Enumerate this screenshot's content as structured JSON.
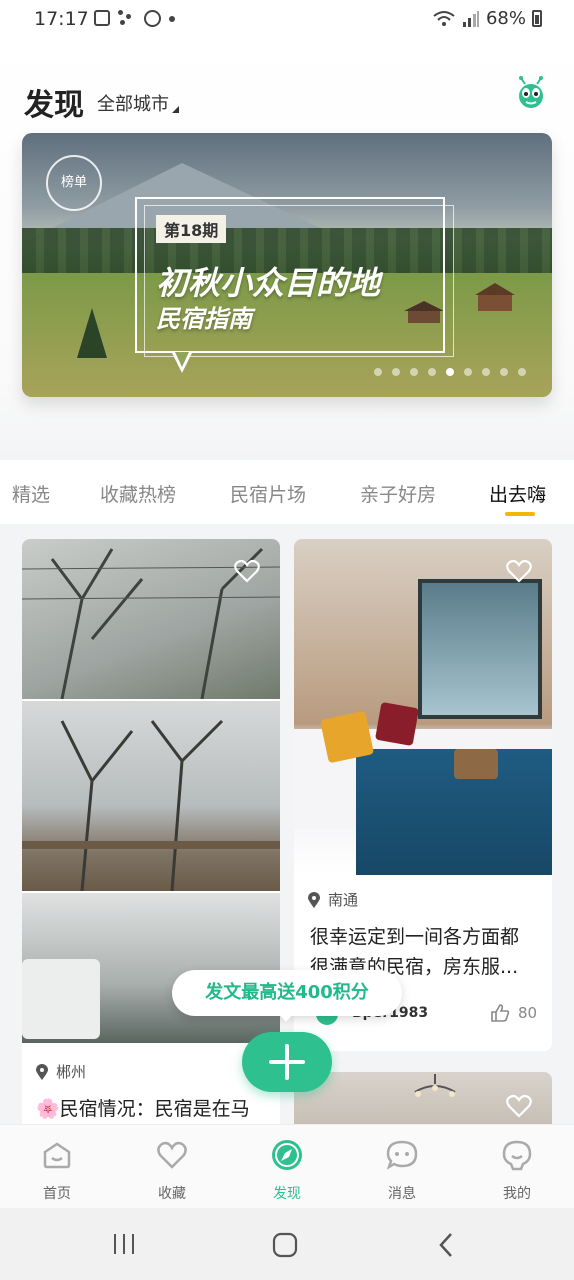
{
  "status_bar": {
    "time": "17:17",
    "battery": "68%"
  },
  "header": {
    "title": "发现",
    "city": "全部城市"
  },
  "banner": {
    "badge": "榜单",
    "issue": "第18期",
    "headline": "初秋小众目的地",
    "subtitle": "民宿指南",
    "page_count": 9,
    "active_page": 5
  },
  "tabs": [
    {
      "label": "精选",
      "active": false
    },
    {
      "label": "收藏热榜",
      "active": false
    },
    {
      "label": "民宿片场",
      "active": false
    },
    {
      "label": "亲子好房",
      "active": false
    },
    {
      "label": "出去嗨",
      "active": true
    }
  ],
  "cards": {
    "left": {
      "location": "郴州",
      "desc_line1": "🌸民宿情况：民宿是在马"
    },
    "right": {
      "location": "南通",
      "desc_line1": "很幸运定到一间各方面都",
      "desc_line2": "很满意的民宿，房东服...",
      "username": "Bper1983",
      "likes": "80"
    }
  },
  "promo": {
    "text": "发文最高送400积分"
  },
  "bottom_nav": [
    {
      "label": "首页",
      "icon": "home-icon"
    },
    {
      "label": "收藏",
      "icon": "heart-icon"
    },
    {
      "label": "发现",
      "icon": "compass-icon",
      "active": true
    },
    {
      "label": "消息",
      "icon": "message-icon"
    },
    {
      "label": "我的",
      "icon": "profile-icon"
    }
  ],
  "colors": {
    "accent": "#2fc08f",
    "tab_indicator": "#f2b705",
    "promo_text": "#22b98a"
  }
}
